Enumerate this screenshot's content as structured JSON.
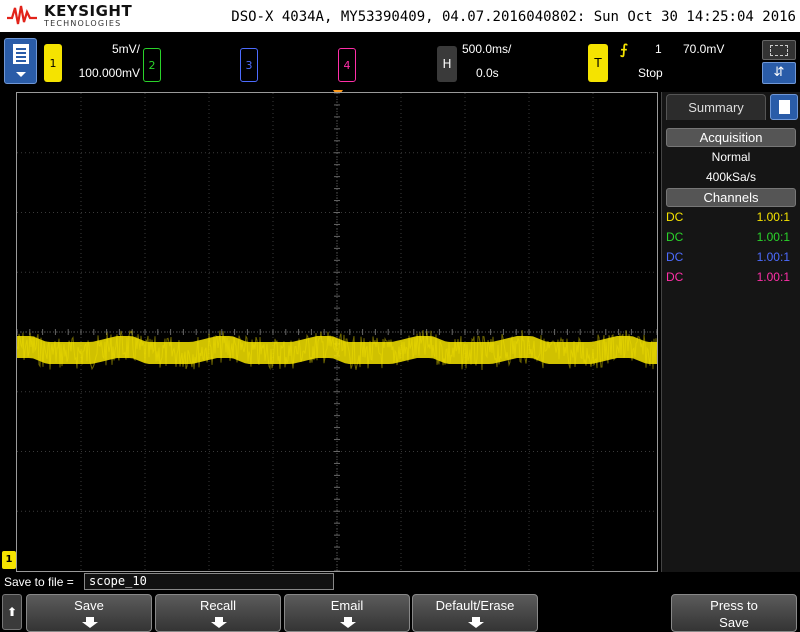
{
  "title_bar": {
    "brand": "KEYSIGHT",
    "brand_sub": "TECHNOLOGIES",
    "instrument_info": "DSO-X 4034A, MY53390409, 04.07.2016040802: Sun Oct 30 14:25:04 2016"
  },
  "channels": {
    "ch1": {
      "number": "1",
      "scale": "5mV/",
      "offset": "100.000mV",
      "color": "#f5e300"
    },
    "ch2": {
      "number": "2",
      "color": "#2ad32a"
    },
    "ch3": {
      "number": "3",
      "color": "#4d6cff"
    },
    "ch4": {
      "number": "4",
      "color": "#ff2fa8"
    }
  },
  "horizontal": {
    "label": "H",
    "time_scale": "500.0ms/",
    "delay": "0.0s"
  },
  "trigger": {
    "label": "T",
    "edge_symbol": "⨍",
    "source": "1",
    "level": "70.0mV",
    "run_state": "Stop"
  },
  "ground_marker": "1",
  "summary_panel": {
    "tab_label": "Summary",
    "acquisition": {
      "heading": "Acquisition",
      "mode": "Normal",
      "sample_rate": "400kSa/s"
    },
    "channels": {
      "heading": "Channels",
      "rows": [
        {
          "coupling": "DC",
          "probe": "1.00:1",
          "color": "#f5e300"
        },
        {
          "coupling": "DC",
          "probe": "1.00:1",
          "color": "#2ad32a"
        },
        {
          "coupling": "DC",
          "probe": "1.00:1",
          "color": "#4d6cff"
        },
        {
          "coupling": "DC",
          "probe": "1.00:1",
          "color": "#ff2fa8"
        }
      ]
    }
  },
  "save_to_file": {
    "label": "Save to file =",
    "value": "scope_10"
  },
  "softkeys": {
    "back": "⬆",
    "save": "Save",
    "recall": "Recall",
    "email": "Email",
    "default_erase": "Default/Erase",
    "press_to_save_line1": "Press to",
    "press_to_save_line2": "Save"
  }
}
